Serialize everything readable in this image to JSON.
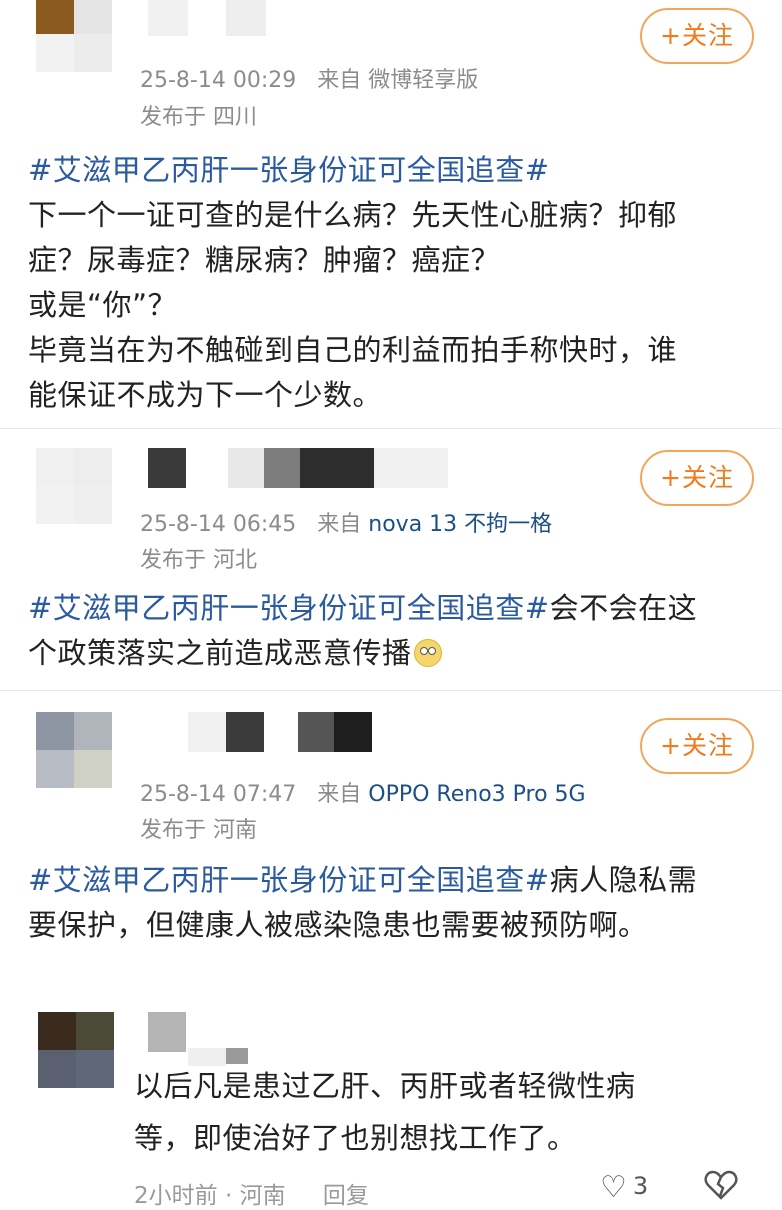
{
  "follow_label": "+关注",
  "posts": [
    {
      "time": "25-8-14 00:29",
      "source_prefix": "来自",
      "device": "微博轻享版",
      "location": "发布于 四川",
      "hashtag": "#艾滋甲乙丙肝一张身份证可全国追查#",
      "text_lines": [
        "下一个一证可查的是什么病？先天性心脏病？抑郁",
        "症？尿毒症？糖尿病？肿瘤？癌症？",
        "或是“你”？",
        "毕竟当在为不触碰到自己的利益而拍手称快时，谁",
        "能保证不成为下一个少数。"
      ]
    },
    {
      "time": "25-8-14 06:45",
      "source_prefix": "来自",
      "device": "nova 13 不拘一格",
      "location": "发布于 河北",
      "hashtag": "#艾滋甲乙丙肝一张身份证可全国追查#",
      "text_first": "会不会在这",
      "text_second": "个政策落实之前造成恶意传播"
    },
    {
      "time": "25-8-14 07:47",
      "source_prefix": "来自",
      "device": "OPPO Reno3 Pro 5G",
      "location": "发布于 河南",
      "hashtag": "#艾滋甲乙丙肝一张身份证可全国追查#",
      "text_first": "病人隐私需",
      "text_second": "要保护，但健康人被感染隐患也需要被预防啊。"
    }
  ],
  "reply": {
    "line1": "以后凡是患过乙肝、丙肝或者轻微性病",
    "line2": "等，即使治好了也别想找工作了。",
    "time": "2小时前 · 河南",
    "reply_label": "回复",
    "likes": "3"
  },
  "colors": {
    "accent": "#ef7b1c",
    "link": "#2a5aa0",
    "meta": "#8c8c8c"
  }
}
